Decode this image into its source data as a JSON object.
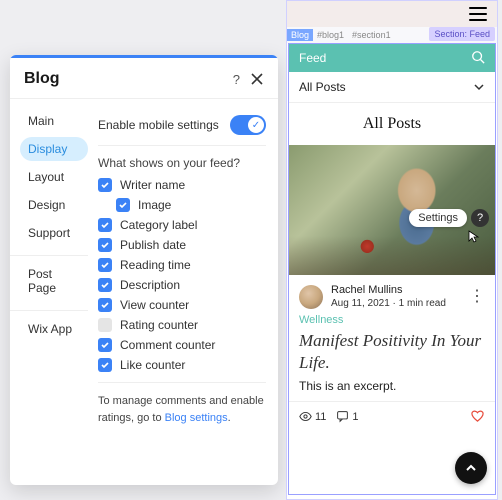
{
  "panel": {
    "title": "Blog",
    "side_items": [
      "Main",
      "Display",
      "Layout",
      "Design",
      "Support"
    ],
    "side_active_index": 1,
    "side_extra": [
      "Post Page",
      "Wix App"
    ],
    "mobile_toggle_label": "Enable mobile settings",
    "mobile_toggle_on": true,
    "question": "What shows on your feed?",
    "options": [
      {
        "label": "Writer name",
        "checked": true,
        "indent": false
      },
      {
        "label": "Image",
        "checked": true,
        "indent": true
      },
      {
        "label": "Category label",
        "checked": true,
        "indent": false
      },
      {
        "label": "Publish date",
        "checked": true,
        "indent": false
      },
      {
        "label": "Reading time",
        "checked": true,
        "indent": false
      },
      {
        "label": "Description",
        "checked": true,
        "indent": false
      },
      {
        "label": "View counter",
        "checked": true,
        "indent": false
      },
      {
        "label": "Rating counter",
        "checked": false,
        "indent": false
      },
      {
        "label": "Comment counter",
        "checked": true,
        "indent": false
      },
      {
        "label": "Like counter",
        "checked": true,
        "indent": false
      }
    ],
    "note_pre": "To manage comments and enable ratings, go to ",
    "note_link": "Blog settings",
    "note_post": "."
  },
  "preview": {
    "crumbs": {
      "blog": "Blog",
      "id": "#blog1",
      "section": "#section1"
    },
    "section_tag": "Section: Feed",
    "feed_header": "Feed",
    "category_selected": "All Posts",
    "posts_heading": "All Posts",
    "settings_pill": "Settings",
    "post": {
      "author": "Rachel Mullins",
      "date": "Aug 11, 2021",
      "dot": "·",
      "read": "1 min read",
      "category": "Wellness",
      "title": "Manifest Positivity In Your Life.",
      "excerpt": "This is an excerpt.",
      "views": "11",
      "comments": "1"
    }
  }
}
